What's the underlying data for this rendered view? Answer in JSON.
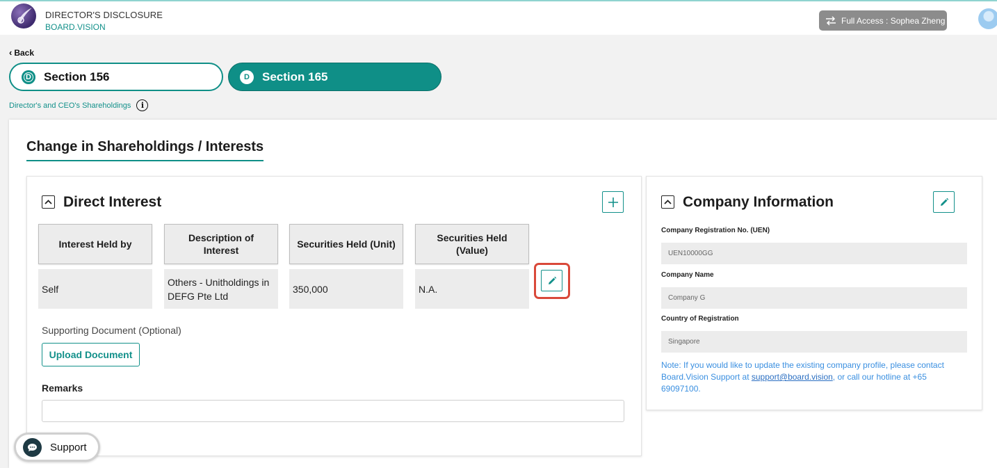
{
  "app": {
    "title": "DIRECTOR'S DISCLOSURE",
    "subtitle": "BOARD.VISION",
    "access_label": "Full Access : Sophea Zheng"
  },
  "nav": {
    "back_label": "Back",
    "tabs": [
      {
        "badge": "D",
        "label": "Section 156",
        "active": false
      },
      {
        "badge": "D",
        "label": "Section 165",
        "active": true
      }
    ],
    "page_subtitle": "Director's and CEO's Shareholdings"
  },
  "main": {
    "heading": "Change in Shareholdings / Interests"
  },
  "direct_interest": {
    "title": "Direct Interest",
    "columns": [
      "Interest Held by",
      "Description of Interest",
      "Securities Held (Unit)",
      "Securities Held (Value)"
    ],
    "rows": [
      [
        "Self",
        "Others - Unitholdings in DEFG Pte Ltd",
        "350,000",
        "N.A."
      ]
    ],
    "supporting_doc_label": "Supporting Document (Optional)",
    "upload_label": "Upload Document",
    "remarks_label": "Remarks",
    "remarks_value": ""
  },
  "company_info": {
    "title": "Company Information",
    "fields": [
      {
        "label": "Company Registration No. (UEN)",
        "value": "UEN10000GG"
      },
      {
        "label": "Company Name",
        "value": "Company G"
      },
      {
        "label": "Country of Registration",
        "value": "Singapore"
      }
    ],
    "note_prefix": "Note: If you would like to update the existing company profile, please contact Board.Vision Support at ",
    "note_email": "support@board.vision",
    "note_suffix": ", or call our hotline at +65 69097100."
  },
  "support": {
    "label": "Support"
  },
  "colors": {
    "accent": "#0f8f87",
    "highlight": "#d9493a",
    "note_text": "#3a8fe0"
  }
}
